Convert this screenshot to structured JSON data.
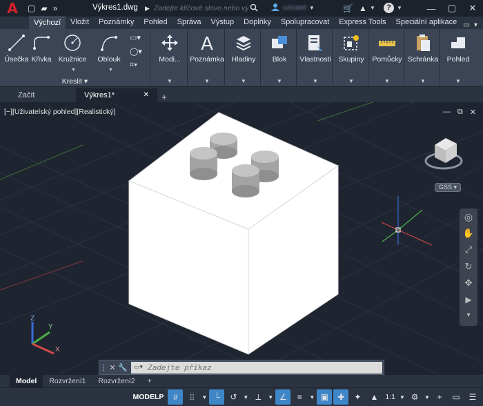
{
  "titlebar": {
    "logo": "A",
    "file_title": "Výkres1.dwg",
    "search_placeholder": "Zadejte klíčové slovo nebo výraz.",
    "user_name": "uzivatel"
  },
  "ribbon_tabs": [
    "Výchozí",
    "Vložit",
    "Poznámky",
    "Pohled",
    "Správa",
    "Výstup",
    "Doplňky",
    "Spolupracovat",
    "Express Tools",
    "Speciální aplikace"
  ],
  "ribbon": {
    "draw_tools": [
      "Úsečka",
      "Křivka",
      "Kružnice",
      "Oblouk"
    ],
    "draw_panel_title": "Kreslit",
    "modify_label": "Modi...",
    "annotation_label": "Poznámka",
    "layers_label": "Hladiny",
    "block_label": "Blok",
    "properties_label": "Vlastnosti",
    "groups_label": "Skupiny",
    "utilities_label": "Pomůcky",
    "clipboard_label": "Schránka",
    "view_label": "Pohled"
  },
  "doc_tabs": [
    "Začít",
    "Výkres1*"
  ],
  "viewport": {
    "label": "[−][Uživatelský pohled][Realistický]",
    "wcs": "GSS",
    "axis_labels": {
      "x": "X",
      "y": "Y",
      "z": "Z"
    }
  },
  "command": {
    "placeholder": "Zadejte příkaz"
  },
  "layout_tabs": [
    "Model",
    "Rozvržení1",
    "Rozvržení2"
  ],
  "statusbar": {
    "space": "MODELP",
    "annotation_scale": "1:1"
  },
  "colors": {
    "accent": "#3f86c7",
    "logo_red": "#d2232a",
    "viewport_bg": "#1f2530"
  }
}
